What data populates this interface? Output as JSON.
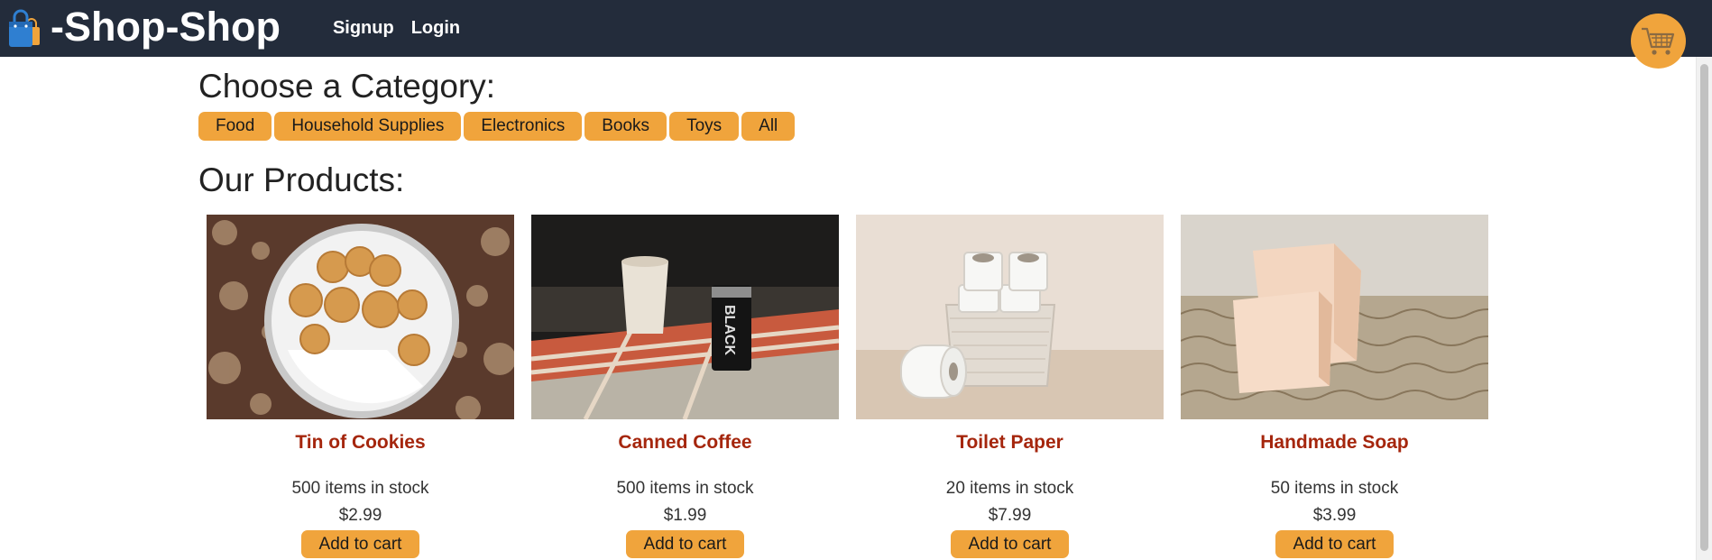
{
  "header": {
    "brand": "-Shop-Shop",
    "brand_icon": "shopping-bags-icon",
    "nav_links": [
      "Signup",
      "Login"
    ],
    "cart_icon": "shopping-cart-icon"
  },
  "categories": {
    "title": "Choose a Category:",
    "items": [
      "Food",
      "Household Supplies",
      "Electronics",
      "Books",
      "Toys",
      "All"
    ]
  },
  "products": {
    "title": "Our Products:",
    "items": [
      {
        "name": "Tin of Cookies",
        "stock": "500 items in stock",
        "price": "$2.99",
        "button": "Add to cart"
      },
      {
        "name": "Canned Coffee",
        "stock": "500 items in stock",
        "price": "$1.99",
        "button": "Add to cart"
      },
      {
        "name": "Toilet Paper",
        "stock": "20 items in stock",
        "price": "$7.99",
        "button": "Add to cart"
      },
      {
        "name": "Handmade Soap",
        "stock": "50 items in stock",
        "price": "$3.99",
        "button": "Add to cart"
      }
    ]
  },
  "colors": {
    "navbar": "#232c3b",
    "accent": "#f0a43c",
    "product_name": "#a5260d"
  }
}
